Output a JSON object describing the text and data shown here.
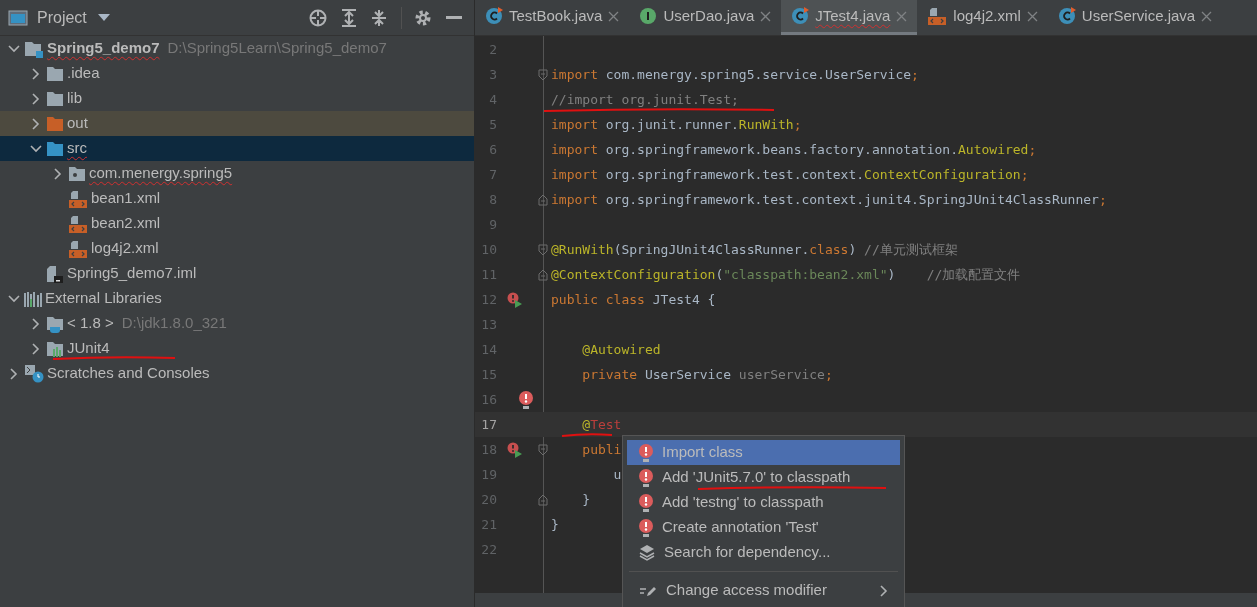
{
  "project_panel": {
    "title": "Project",
    "tree": [
      {
        "label": "Spring5_demo7",
        "hint": "D:\\Spring5Learn\\Spring5_demo7",
        "kind": "module",
        "misspelled": true,
        "selected": false,
        "expanded": true,
        "children": [
          {
            "label": ".idea",
            "kind": "folder",
            "selected": false,
            "expanded": false
          },
          {
            "label": "lib",
            "kind": "folder",
            "selected": false,
            "expanded": false
          },
          {
            "label": "out",
            "kind": "excluded-folder",
            "selected": false,
            "expanded": false
          },
          {
            "label": "src",
            "kind": "source-folder",
            "misspelled": true,
            "selected": true,
            "expanded": true,
            "children": [
              {
                "label": "com.menergy.spring5",
                "kind": "package",
                "misspelled": true,
                "selected": false,
                "expanded": false
              },
              {
                "label": "bean1.xml",
                "kind": "xml",
                "selected": false
              },
              {
                "label": "bean2.xml",
                "kind": "xml",
                "selected": false
              },
              {
                "label": "log4j2.xml",
                "kind": "xml",
                "selected": false
              }
            ]
          },
          {
            "label": "Spring5_demo7.iml",
            "kind": "iml",
            "selected": false
          }
        ]
      },
      {
        "label": "External Libraries",
        "kind": "libraries",
        "selected": false,
        "expanded": true,
        "children": [
          {
            "label": "< 1.8 >",
            "hint": "D:\\jdk1.8.0_321",
            "kind": "jdk",
            "selected": false,
            "expanded": false
          },
          {
            "label": "JUnit4",
            "kind": "library",
            "annotated": true,
            "selected": false,
            "expanded": false
          }
        ]
      },
      {
        "label": "Scratches and Consoles",
        "kind": "scratches",
        "selected": false,
        "expanded": false
      }
    ]
  },
  "tabs": [
    {
      "label": "TestBook.java",
      "kind": "class",
      "selected": false
    },
    {
      "label": "UserDao.java",
      "kind": "interface",
      "selected": false
    },
    {
      "label": "JTest4.java",
      "kind": "class",
      "selected": true,
      "misspelled": true
    },
    {
      "label": "log4j2.xml",
      "kind": "xml",
      "selected": false
    },
    {
      "label": "UserService.java",
      "kind": "class",
      "selected": false
    }
  ],
  "code_lines": [
    {
      "number": "2"
    },
    {
      "number": "3",
      "fold_start": true,
      "tokens": [
        {
          "text": "import",
          "kind": "keyword"
        },
        {
          "text": " com.menergy.spring5.service.UserService",
          "kind": "plain"
        },
        {
          "text": ";",
          "kind": "keyword"
        }
      ]
    },
    {
      "number": "4",
      "annotated": true,
      "tokens": [
        {
          "text": "//import org.junit.Test;",
          "kind": "comment"
        }
      ]
    },
    {
      "number": "5",
      "tokens": [
        {
          "text": "import",
          "kind": "keyword"
        },
        {
          "text": " org.junit.runner.",
          "kind": "plain"
        },
        {
          "text": "RunWith",
          "kind": "annotation"
        },
        {
          "text": ";",
          "kind": "keyword"
        }
      ]
    },
    {
      "number": "6",
      "tokens": [
        {
          "text": "import",
          "kind": "keyword"
        },
        {
          "text": " org.springframework.beans.factory.annotation.",
          "kind": "plain"
        },
        {
          "text": "Autowired",
          "kind": "annotation"
        },
        {
          "text": ";",
          "kind": "keyword"
        }
      ]
    },
    {
      "number": "7",
      "tokens": [
        {
          "text": "import",
          "kind": "keyword"
        },
        {
          "text": " org.springframework.test.context.",
          "kind": "plain"
        },
        {
          "text": "ContextConfiguration",
          "kind": "annotation"
        },
        {
          "text": ";",
          "kind": "keyword"
        }
      ]
    },
    {
      "number": "8",
      "fold_end": true,
      "tokens": [
        {
          "text": "import",
          "kind": "keyword"
        },
        {
          "text": " org.springframework.test.context.junit4.SpringJUnit4ClassRunner",
          "kind": "plain"
        },
        {
          "text": ";",
          "kind": "keyword"
        }
      ]
    },
    {
      "number": "9"
    },
    {
      "number": "10",
      "fold_start": true,
      "tokens": [
        {
          "text": "@RunWith",
          "kind": "annotation"
        },
        {
          "text": "(SpringJUnit4ClassRunner.",
          "kind": "plain"
        },
        {
          "text": "class",
          "kind": "keyword"
        },
        {
          "text": ") ",
          "kind": "plain"
        },
        {
          "text": "//单元测试框架",
          "kind": "comment"
        }
      ]
    },
    {
      "number": "11",
      "fold_end": true,
      "tokens": [
        {
          "text": "@ContextConfiguration",
          "kind": "annotation"
        },
        {
          "text": "(",
          "kind": "plain"
        },
        {
          "text": "\"classpath:bean2.xml\"",
          "kind": "string"
        },
        {
          "text": ")    ",
          "kind": "plain"
        },
        {
          "text": "//加载配置文件",
          "kind": "comment"
        }
      ]
    },
    {
      "number": "12",
      "run": true,
      "tokens": [
        {
          "text": "public class",
          "kind": "keyword"
        },
        {
          "text": " JTest4 {",
          "kind": "plain"
        }
      ]
    },
    {
      "number": "13"
    },
    {
      "number": "14",
      "tokens": [
        {
          "text": "    @Autowired",
          "kind": "annotation"
        }
      ]
    },
    {
      "number": "15",
      "tokens": [
        {
          "text": "    private",
          "kind": "keyword"
        },
        {
          "text": " UserService ",
          "kind": "plain"
        },
        {
          "text": "userService",
          "kind": "unused"
        },
        {
          "text": ";",
          "kind": "keyword"
        }
      ]
    },
    {
      "number": "16",
      "bulb": true
    },
    {
      "number": "17",
      "current": true,
      "annotated": true,
      "tokens": [
        {
          "text": "    @",
          "kind": "annotation"
        },
        {
          "text": "Test",
          "kind": "error"
        }
      ]
    },
    {
      "number": "18",
      "run": true,
      "fold_start": true,
      "tokens": [
        {
          "text": "    publi",
          "kind": "keyword"
        }
      ]
    },
    {
      "number": "19",
      "tokens": [
        {
          "text": "        u",
          "kind": "plain"
        }
      ]
    },
    {
      "number": "20",
      "fold_end": true,
      "tokens": [
        {
          "text": "    }",
          "kind": "plain"
        }
      ]
    },
    {
      "number": "21",
      "tokens": [
        {
          "text": "}",
          "kind": "plain"
        }
      ]
    },
    {
      "number": "22"
    }
  ],
  "intention_menu": {
    "items": [
      {
        "label": "Import class",
        "kind": "bulb",
        "selected": true
      },
      {
        "label": "Add 'JUnit5.7.0' to classpath",
        "kind": "bulb",
        "annotated": true,
        "selected": false
      },
      {
        "label": "Add 'testng' to classpath",
        "kind": "bulb",
        "selected": false
      },
      {
        "label": "Create annotation 'Test'",
        "kind": "bulb",
        "selected": false
      },
      {
        "label": "Search for dependency...",
        "kind": "layers",
        "selected": false
      },
      {
        "label": "Change access modifier",
        "kind": "edit",
        "submenu": true,
        "separator_before": true,
        "selected": false
      }
    ]
  }
}
